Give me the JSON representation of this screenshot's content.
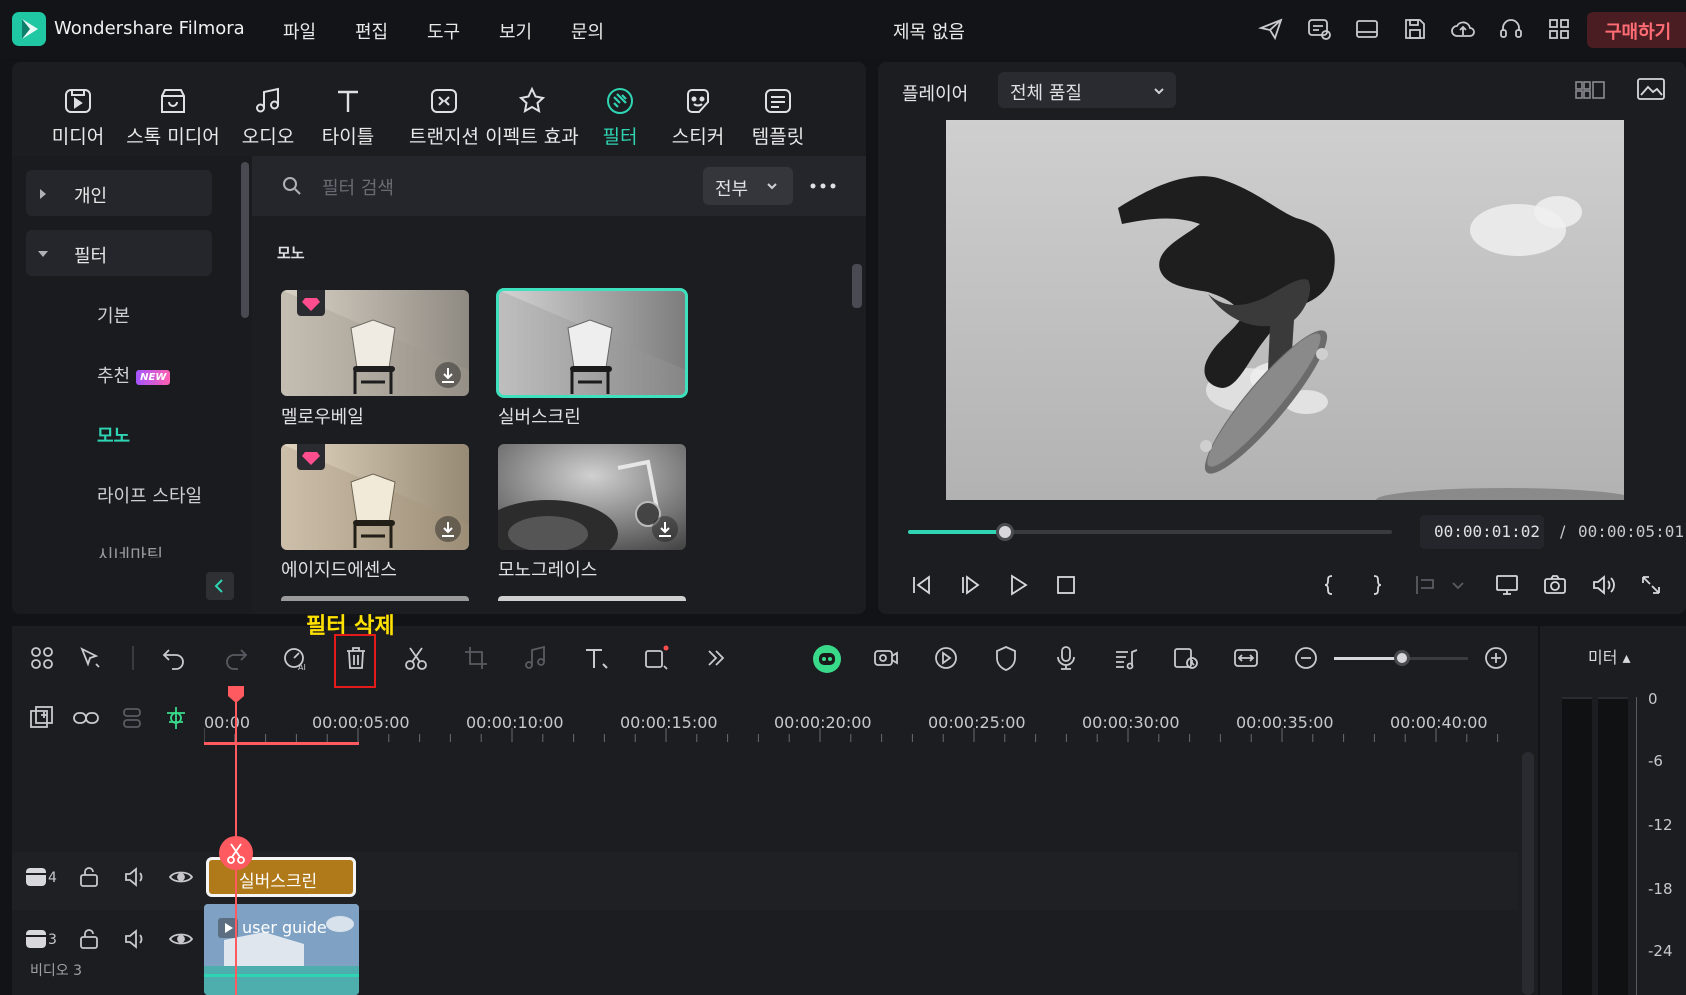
{
  "app": {
    "name": "Wondershare Filmora",
    "doc_title": "제목 없음",
    "buy_label": "구매하기"
  },
  "menu": [
    "파일",
    "편집",
    "도구",
    "보기",
    "문의"
  ],
  "categories": [
    {
      "label": "미디어",
      "icon": "media-icon"
    },
    {
      "label": "스톡 미디어",
      "icon": "stock-media-icon"
    },
    {
      "label": "오디오",
      "icon": "audio-icon"
    },
    {
      "label": "타이틀",
      "icon": "title-icon"
    },
    {
      "label": "트랜지션",
      "icon": "transition-icon"
    },
    {
      "label": "이펙트 효과",
      "icon": "effects-icon"
    },
    {
      "label": "필터",
      "icon": "filter-icon"
    },
    {
      "label": "스티커",
      "icon": "sticker-icon"
    },
    {
      "label": "템플릿",
      "icon": "template-icon"
    }
  ],
  "sidebar": {
    "personal": "개인",
    "filter": "필터",
    "items": [
      "기본",
      "추천",
      "모노",
      "라이프 스타일",
      "시네마틱"
    ],
    "new_badge": "NEW"
  },
  "search": {
    "placeholder": "필터 검색",
    "dropdown": "전부"
  },
  "section_title": "모노",
  "thumbnails": [
    {
      "label": "멜로우베일",
      "premium": true,
      "selected": false
    },
    {
      "label": "실버스크린",
      "premium": false,
      "selected": true
    },
    {
      "label": "에이지드에센스",
      "premium": true,
      "selected": false
    },
    {
      "label": "모노그레이스",
      "premium": false,
      "selected": false
    }
  ],
  "player": {
    "label": "플레이어",
    "quality": "전체 품질",
    "current_time": "00:00:01:02",
    "total_time": "00:00:05:01",
    "progress": 0.2
  },
  "annotation": "필터 삭제",
  "ruler": [
    "00:00",
    "00:00:05:00",
    "00:00:10:00",
    "00:00:15:00",
    "00:00:20:00",
    "00:00:25:00",
    "00:00:30:00",
    "00:00:35:00",
    "00:00:40:00"
  ],
  "tracks": [
    {
      "number": "4",
      "clip": "실버스크린"
    },
    {
      "number": "3",
      "clip": "user guide",
      "name": "비디오 3"
    }
  ],
  "meter": {
    "label": "미터",
    "scale": [
      "0",
      "-6",
      "-12",
      "-18",
      "-24"
    ]
  },
  "colors": {
    "accent": "#2fd4b2",
    "clip_filter": "#b07a1a",
    "playhead": "#ff5a5f",
    "annotation": "#ffe100",
    "highlight_box": "#e31b1b"
  }
}
